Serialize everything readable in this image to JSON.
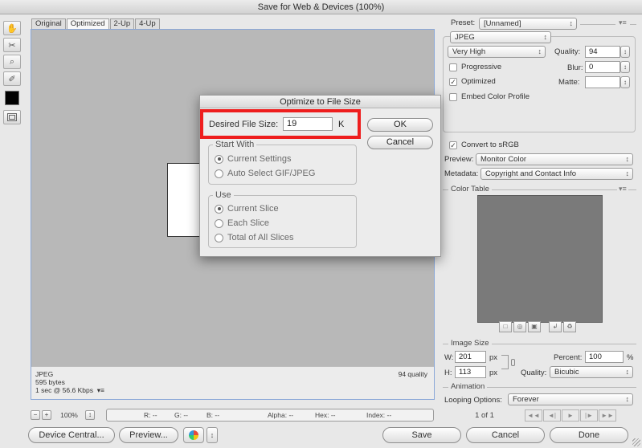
{
  "window": {
    "title": "Save for Web & Devices (100%)"
  },
  "tabs": [
    "Original",
    "Optimized",
    "2-Up",
    "4-Up"
  ],
  "active_tab": "Optimized",
  "tools": [
    {
      "icon": "hand-icon",
      "glyph": "✋"
    },
    {
      "icon": "slice-select-icon",
      "glyph": "✂"
    },
    {
      "icon": "zoom-icon",
      "glyph": "⌕"
    },
    {
      "icon": "eyedropper-icon",
      "glyph": "✐"
    }
  ],
  "eyedropper_color": "#000000",
  "canvas_info": {
    "format": "JPEG",
    "size": "595 bytes",
    "time": "1 sec @ 56.6 Kbps",
    "menu": "▾≡",
    "quality": "94 quality"
  },
  "statusbar": {
    "minus": "−",
    "plus": "+",
    "zoom": "100%",
    "zoom_arrows": "↕",
    "r": "R: --",
    "g": "G: --",
    "b": "B: --",
    "alpha": "Alpha: --",
    "hex": "Hex: --",
    "index": "Index: --"
  },
  "bottom_buttons": {
    "device_central": "Device Central...",
    "preview": "Preview...",
    "save": "Save",
    "cancel": "Cancel",
    "done": "Done"
  },
  "settings": {
    "preset_label": "Preset:",
    "preset_value": "[Unnamed]",
    "menu": "▾≡",
    "format": "JPEG",
    "compression": "Very High",
    "quality_label": "Quality:",
    "quality_value": "94",
    "progressive_label": "Progressive",
    "blur_label": "Blur:",
    "blur_value": "0",
    "optimized_label": "Optimized",
    "matte_label": "Matte:",
    "embed_profile_label": "Embed Color Profile",
    "check_mark": "✓",
    "convert_srgb_label": "Convert to sRGB",
    "preview_label": "Preview:",
    "preview_value": "Monitor Color",
    "metadata_label": "Metadata:",
    "metadata_value": "Copyright and Contact Info",
    "color_table_title": "Color Table",
    "color_table_tools": [
      "□",
      "◎",
      "▣",
      "↲",
      "♻"
    ]
  },
  "image_size": {
    "title": "Image Size",
    "w_label": "W:",
    "w_value": "201",
    "h_label": "H:",
    "h_value": "113",
    "px": "px",
    "percent_label": "Percent:",
    "percent_value": "100",
    "percent_unit": "%",
    "quality_label": "Quality:",
    "quality_value": "Bicubic"
  },
  "animation": {
    "title": "Animation",
    "looping_label": "Looping Options:",
    "looping_value": "Forever",
    "frame": "1 of 1",
    "controls": [
      "◄◄",
      "◄|",
      "►",
      "|►",
      "►►"
    ]
  },
  "dialog": {
    "title": "Optimize to File Size",
    "desired_label": "Desired File Size:",
    "desired_value": "19",
    "unit": "K",
    "ok": "OK",
    "cancel": "Cancel",
    "start_with_title": "Start With",
    "start_with": [
      "Current Settings",
      "Auto Select GIF/JPEG"
    ],
    "use_title": "Use",
    "use": [
      "Current Slice",
      "Each Slice",
      "Total of All Slices"
    ]
  },
  "highlight_color": "#ee1d1d"
}
